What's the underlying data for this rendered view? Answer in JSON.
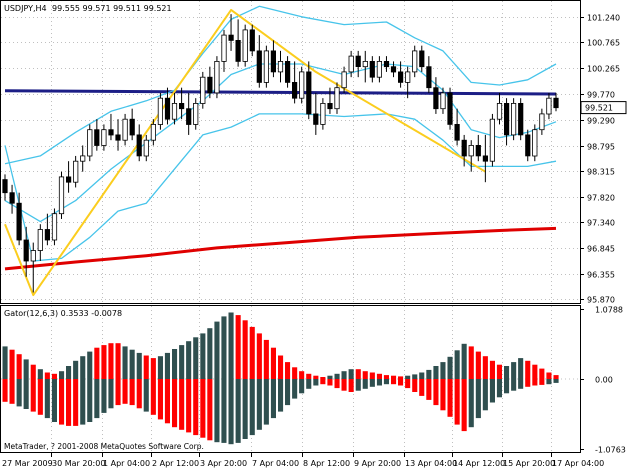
{
  "main_chart": {
    "header": {
      "symbol": "USDJPY,H4",
      "ohlc": "99.555 99.571 99.511 99.521"
    },
    "price_axis_labels": [
      "101.240",
      "100.765",
      "100.265",
      "99.770",
      "99.290",
      "98.795",
      "98.315",
      "97.820",
      "97.340",
      "96.845",
      "96.355",
      "95.870"
    ],
    "price_axis_values": [
      101.24,
      100.765,
      100.265,
      99.77,
      99.29,
      98.795,
      98.315,
      97.82,
      97.34,
      96.845,
      96.355,
      95.87
    ],
    "current_price_tag": "99.521",
    "chart_data": {
      "type": "candlestick",
      "ylim": [
        95.8,
        101.55
      ],
      "grid": true,
      "candles": [
        [
          98.15,
          98.25,
          97.75,
          97.9
        ],
        [
          97.9,
          98.05,
          97.5,
          97.7
        ],
        [
          97.7,
          97.9,
          96.9,
          97.0
        ],
        [
          97.0,
          97.25,
          96.3,
          96.6
        ],
        [
          96.6,
          96.95,
          96.0,
          96.8
        ],
        [
          96.8,
          97.3,
          96.6,
          97.2
        ],
        [
          97.2,
          97.5,
          96.9,
          97.0
        ],
        [
          97.0,
          97.6,
          96.9,
          97.5
        ],
        [
          97.5,
          98.3,
          97.4,
          98.2
        ],
        [
          98.2,
          98.5,
          97.9,
          98.1
        ],
        [
          98.1,
          98.6,
          98.0,
          98.5
        ],
        [
          98.5,
          98.8,
          98.3,
          98.6
        ],
        [
          98.6,
          99.2,
          98.5,
          99.1
        ],
        [
          99.1,
          99.3,
          98.7,
          98.8
        ],
        [
          98.8,
          99.2,
          98.7,
          99.1
        ],
        [
          99.1,
          99.4,
          98.9,
          99.0
        ],
        [
          99.0,
          99.3,
          98.7,
          98.9
        ],
        [
          98.9,
          99.4,
          98.8,
          99.3
        ],
        [
          99.3,
          99.5,
          98.9,
          99.0
        ],
        [
          99.0,
          99.2,
          98.5,
          98.6
        ],
        [
          98.6,
          99.0,
          98.5,
          98.9
        ],
        [
          98.9,
          99.3,
          98.8,
          99.2
        ],
        [
          99.2,
          99.8,
          99.1,
          99.7
        ],
        [
          99.7,
          99.9,
          99.2,
          99.3
        ],
        [
          99.3,
          99.8,
          99.2,
          99.6
        ],
        [
          99.6,
          99.9,
          99.3,
          99.5
        ],
        [
          99.5,
          99.8,
          99.0,
          99.2
        ],
        [
          99.2,
          99.7,
          99.1,
          99.6
        ],
        [
          99.6,
          100.2,
          99.5,
          100.1
        ],
        [
          100.1,
          100.3,
          99.7,
          99.8
        ],
        [
          99.8,
          100.5,
          99.7,
          100.4
        ],
        [
          100.4,
          101.0,
          100.2,
          100.9
        ],
        [
          100.9,
          101.3,
          100.6,
          100.8
        ],
        [
          100.8,
          101.2,
          100.3,
          100.4
        ],
        [
          100.4,
          101.1,
          100.3,
          101.0
        ],
        [
          101.0,
          101.1,
          100.5,
          100.6
        ],
        [
          100.6,
          100.9,
          99.9,
          100.0
        ],
        [
          100.0,
          100.7,
          99.9,
          100.6
        ],
        [
          100.6,
          100.8,
          100.1,
          100.2
        ],
        [
          100.2,
          100.6,
          100.0,
          100.4
        ],
        [
          100.4,
          100.5,
          99.9,
          100.0
        ],
        [
          100.0,
          100.4,
          99.6,
          99.7
        ],
        [
          99.7,
          100.3,
          99.6,
          100.2
        ],
        [
          100.2,
          100.4,
          99.3,
          99.4
        ],
        [
          99.4,
          99.8,
          99.0,
          99.2
        ],
        [
          99.2,
          99.7,
          99.1,
          99.6
        ],
        [
          99.6,
          99.9,
          99.4,
          99.5
        ],
        [
          99.5,
          100.0,
          99.4,
          99.9
        ],
        [
          99.9,
          100.3,
          99.8,
          100.2
        ],
        [
          100.2,
          100.6,
          100.1,
          100.5
        ],
        [
          100.5,
          100.6,
          100.1,
          100.3
        ],
        [
          100.3,
          100.6,
          100.0,
          100.4
        ],
        [
          100.4,
          100.5,
          100.0,
          100.1
        ],
        [
          100.1,
          100.5,
          100.0,
          100.4
        ],
        [
          100.4,
          100.5,
          100.2,
          100.3
        ],
        [
          100.3,
          100.4,
          100.1,
          100.2
        ],
        [
          100.2,
          100.4,
          99.9,
          100.0
        ],
        [
          100.0,
          100.3,
          99.7,
          100.2
        ],
        [
          100.2,
          100.7,
          100.1,
          100.6
        ],
        [
          100.6,
          100.7,
          100.2,
          100.3
        ],
        [
          100.3,
          100.5,
          99.8,
          99.9
        ],
        [
          99.9,
          100.1,
          99.4,
          99.5
        ],
        [
          99.5,
          99.9,
          99.4,
          99.8
        ],
        [
          99.8,
          99.9,
          99.1,
          99.2
        ],
        [
          99.2,
          99.5,
          98.8,
          98.9
        ],
        [
          98.9,
          99.0,
          98.4,
          98.6
        ],
        [
          98.6,
          98.9,
          98.3,
          98.8
        ],
        [
          98.8,
          99.0,
          98.5,
          98.6
        ],
        [
          98.6,
          99.0,
          98.1,
          98.5
        ],
        [
          98.5,
          99.4,
          98.4,
          99.3
        ],
        [
          99.3,
          99.8,
          99.2,
          99.6
        ],
        [
          99.6,
          99.7,
          98.8,
          99.0
        ],
        [
          99.0,
          99.7,
          98.9,
          99.6
        ],
        [
          99.6,
          99.7,
          98.9,
          99.0
        ],
        [
          99.0,
          99.1,
          98.5,
          98.6
        ],
        [
          98.6,
          99.2,
          98.5,
          99.1
        ],
        [
          99.1,
          99.5,
          99.0,
          99.4
        ],
        [
          99.4,
          99.8,
          99.3,
          99.7
        ],
        [
          99.7,
          99.8,
          99.45,
          99.52
        ]
      ],
      "bollinger_upper": [
        [
          0,
          98.45
        ],
        [
          5,
          98.6
        ],
        [
          10,
          99.05
        ],
        [
          15,
          99.45
        ],
        [
          20,
          99.65
        ],
        [
          24,
          99.85
        ],
        [
          28,
          100.55
        ],
        [
          32,
          101.2
        ],
        [
          36,
          101.45
        ],
        [
          42,
          101.25
        ],
        [
          48,
          101.1
        ],
        [
          54,
          101.15
        ],
        [
          58,
          100.85
        ],
        [
          62,
          100.6
        ],
        [
          66,
          100.0
        ],
        [
          70,
          99.95
        ],
        [
          74,
          100.05
        ],
        [
          78,
          100.35
        ]
      ],
      "bollinger_middle": [
        [
          0,
          97.75
        ],
        [
          5,
          97.35
        ],
        [
          10,
          97.75
        ],
        [
          15,
          98.35
        ],
        [
          20,
          98.85
        ],
        [
          24,
          99.25
        ],
        [
          28,
          99.65
        ],
        [
          32,
          100.15
        ],
        [
          36,
          100.35
        ],
        [
          42,
          100.35
        ],
        [
          48,
          100.15
        ],
        [
          54,
          100.35
        ],
        [
          58,
          100.3
        ],
        [
          62,
          99.85
        ],
        [
          66,
          99.1
        ],
        [
          70,
          98.95
        ],
        [
          74,
          99.05
        ],
        [
          78,
          99.25
        ]
      ],
      "bollinger_lower": [
        [
          0,
          98.8
        ],
        [
          4,
          96.6
        ],
        [
          8,
          96.65
        ],
        [
          12,
          97.05
        ],
        [
          16,
          97.55
        ],
        [
          20,
          97.7
        ],
        [
          24,
          98.35
        ],
        [
          28,
          99.0
        ],
        [
          32,
          99.15
        ],
        [
          36,
          99.4
        ],
        [
          42,
          99.4
        ],
        [
          48,
          99.35
        ],
        [
          54,
          99.4
        ],
        [
          58,
          99.3
        ],
        [
          62,
          98.9
        ],
        [
          66,
          98.4
        ],
        [
          70,
          98.4
        ],
        [
          74,
          98.4
        ],
        [
          78,
          98.5
        ]
      ],
      "moving_average_flat": [
        [
          0,
          99.84
        ],
        [
          78,
          99.78
        ]
      ],
      "moving_average_slow": [
        [
          0,
          96.45
        ],
        [
          10,
          96.58
        ],
        [
          20,
          96.7
        ],
        [
          30,
          96.85
        ],
        [
          40,
          96.95
        ],
        [
          50,
          97.05
        ],
        [
          60,
          97.12
        ],
        [
          70,
          97.18
        ],
        [
          78,
          97.22
        ]
      ],
      "zigzag": [
        [
          0,
          97.3
        ],
        [
          4,
          95.95
        ],
        [
          32,
          101.38
        ],
        [
          44,
          100.2
        ],
        [
          68,
          98.3
        ]
      ],
      "series_colors": {
        "candle": "#000000",
        "bollinger": "#47c4ea",
        "moving_average_flat": "#1c1e86",
        "moving_average_slow": "#df0000",
        "zigzag": "#fbcd1e"
      }
    }
  },
  "indicator": {
    "header": "Gator(12,6,3) 0.3533 -0.0078",
    "axis_labels": [
      "1.0788",
      "0.00",
      "-1.0763"
    ],
    "chart_data": {
      "type": "bar",
      "ylim": [
        -1.12,
        1.12
      ],
      "colors": {
        "up": "#ff0000",
        "down": "#2f4f4f"
      },
      "upper_values": [
        0.5,
        0.45,
        0.38,
        0.3,
        0.22,
        0.15,
        0.1,
        0.08,
        0.12,
        0.2,
        0.28,
        0.35,
        0.42,
        0.48,
        0.52,
        0.55,
        0.55,
        0.5,
        0.45,
        0.4,
        0.36,
        0.32,
        0.35,
        0.4,
        0.46,
        0.52,
        0.58,
        0.64,
        0.7,
        0.78,
        0.88,
        0.96,
        1.02,
        0.98,
        0.9,
        0.8,
        0.7,
        0.6,
        0.48,
        0.36,
        0.26,
        0.18,
        0.12,
        0.08,
        0.05,
        0.03,
        0.05,
        0.08,
        0.12,
        0.15,
        0.15,
        0.12,
        0.1,
        0.08,
        0.06,
        0.05,
        0.04,
        0.05,
        0.07,
        0.1,
        0.14,
        0.2,
        0.26,
        0.34,
        0.44,
        0.54,
        0.5,
        0.42,
        0.35,
        0.28,
        0.22,
        0.2,
        0.26,
        0.32,
        0.28,
        0.22,
        0.16,
        0.1,
        0.06
      ],
      "upper_colors": [
        "d",
        "u",
        "u",
        "d",
        "u",
        "d",
        "u",
        "u",
        "d",
        "d",
        "d",
        "d",
        "d",
        "u",
        "u",
        "u",
        "u",
        "d",
        "d",
        "d",
        "u",
        "u",
        "d",
        "d",
        "d",
        "d",
        "d",
        "d",
        "d",
        "d",
        "d",
        "d",
        "d",
        "u",
        "u",
        "u",
        "u",
        "u",
        "u",
        "u",
        "u",
        "u",
        "u",
        "u",
        "u",
        "u",
        "d",
        "d",
        "d",
        "d",
        "u",
        "u",
        "u",
        "u",
        "u",
        "u",
        "u",
        "d",
        "d",
        "d",
        "d",
        "d",
        "d",
        "d",
        "d",
        "d",
        "u",
        "u",
        "u",
        "u",
        "u",
        "d",
        "d",
        "d",
        "u",
        "u",
        "u",
        "u",
        "u"
      ],
      "lower_values": [
        0.35,
        0.38,
        0.42,
        0.46,
        0.5,
        0.55,
        0.6,
        0.66,
        0.7,
        0.72,
        0.72,
        0.7,
        0.66,
        0.6,
        0.52,
        0.45,
        0.4,
        0.38,
        0.4,
        0.45,
        0.5,
        0.55,
        0.62,
        0.68,
        0.74,
        0.78,
        0.82,
        0.86,
        0.9,
        0.94,
        0.97,
        0.98,
        1.0,
        0.98,
        0.92,
        0.86,
        0.78,
        0.7,
        0.6,
        0.5,
        0.4,
        0.3,
        0.22,
        0.15,
        0.1,
        0.08,
        0.1,
        0.14,
        0.18,
        0.2,
        0.18,
        0.15,
        0.12,
        0.1,
        0.08,
        0.08,
        0.1,
        0.14,
        0.2,
        0.26,
        0.32,
        0.4,
        0.48,
        0.58,
        0.7,
        0.8,
        0.74,
        0.6,
        0.48,
        0.36,
        0.28,
        0.22,
        0.18,
        0.15,
        0.12,
        0.1,
        0.09,
        0.08,
        0.06
      ],
      "lower_colors": [
        "u",
        "u",
        "d",
        "d",
        "u",
        "u",
        "d",
        "d",
        "u",
        "u",
        "u",
        "d",
        "d",
        "d",
        "d",
        "d",
        "u",
        "u",
        "u",
        "u",
        "d",
        "u",
        "u",
        "u",
        "u",
        "u",
        "u",
        "u",
        "u",
        "u",
        "d",
        "d",
        "d",
        "d",
        "d",
        "d",
        "d",
        "d",
        "d",
        "d",
        "d",
        "d",
        "d",
        "d",
        "d",
        "u",
        "u",
        "u",
        "u",
        "u",
        "d",
        "d",
        "d",
        "d",
        "d",
        "u",
        "u",
        "u",
        "u",
        "u",
        "u",
        "u",
        "u",
        "u",
        "u",
        "u",
        "d",
        "d",
        "d",
        "d",
        "d",
        "d",
        "d",
        "d",
        "u",
        "u",
        "u",
        "d",
        "d"
      ]
    }
  },
  "time_axis_labels": [
    "27 Mar 2009",
    "30 Mar 20:00",
    "1 Apr 04:00",
    "2 Apr 12:00",
    "3 Apr 20:00",
    "7 Apr 04:00",
    "8 Apr 12:00",
    "9 Apr 20:00",
    "13 Apr 04:00",
    "14 Apr 12:00",
    "15 Apr 20:00",
    "17 Apr 04:00"
  ],
  "copyright": "MetaTrader, ? 2001-2008 MetaQuotes Software Corp."
}
